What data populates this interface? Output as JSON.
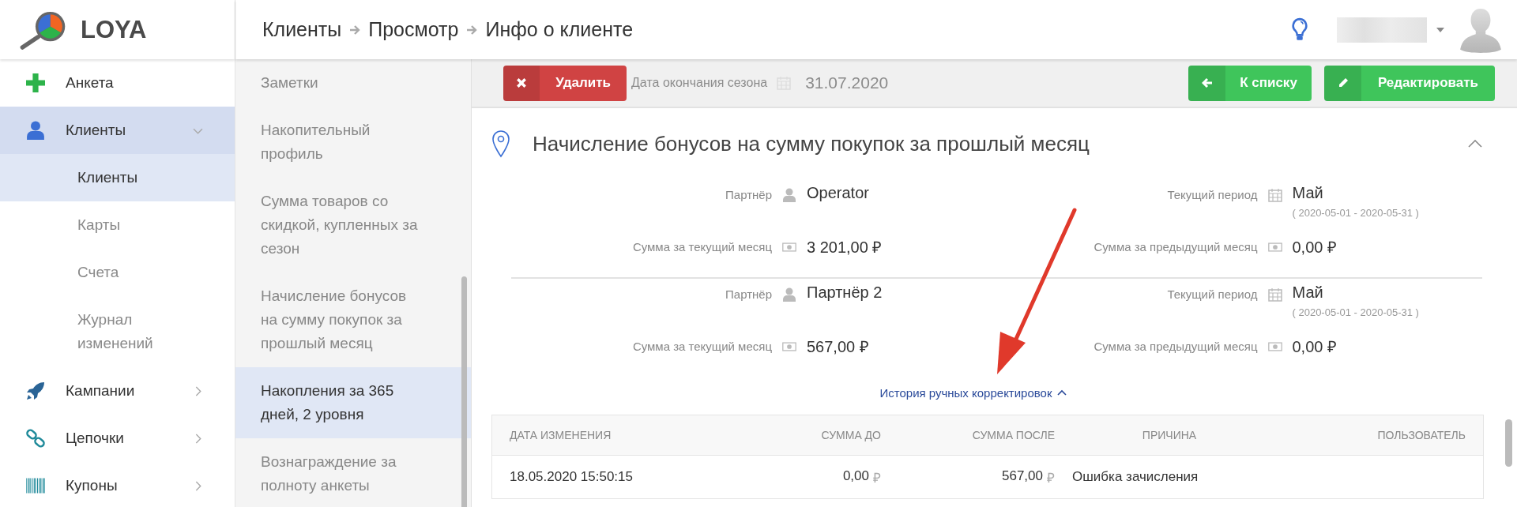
{
  "logo": {
    "text": "LOYA"
  },
  "breadcrumbs": [
    "Клиенты",
    "Просмотр",
    "Инфо о клиенте"
  ],
  "sidebar": {
    "items": [
      {
        "label": "Анкета",
        "kind": "link",
        "selected": false
      },
      {
        "label": "Клиенты",
        "kind": "group",
        "selected": true,
        "expanded": true,
        "children": [
          {
            "label": "Клиенты",
            "selected": true
          },
          {
            "label": "Карты",
            "selected": false
          },
          {
            "label": "Счета",
            "selected": false
          },
          {
            "label": "Журнал изменений",
            "selected": false
          }
        ]
      },
      {
        "label": "Кампании",
        "kind": "group",
        "selected": false,
        "expanded": false
      },
      {
        "label": "Цепочки",
        "kind": "group",
        "selected": false,
        "expanded": false
      },
      {
        "label": "Купоны",
        "kind": "group",
        "selected": false,
        "expanded": false
      }
    ]
  },
  "section_nav": {
    "items": [
      {
        "label": "Заметки",
        "selected": false
      },
      {
        "label": "Накопительный профиль",
        "selected": false
      },
      {
        "label": "Сумма товаров со скидкой, купленных за сезон",
        "selected": false
      },
      {
        "label": "Начисление бонусов на сумму покупок за прошлый месяц",
        "selected": false
      },
      {
        "label": "Накопления за 365 дней, 2 уровня",
        "selected": true
      },
      {
        "label": "Вознаграждение за полноту анкеты",
        "selected": false
      }
    ]
  },
  "toolbar": {
    "delete_button": "Удалить",
    "hidden_field": {
      "label": "Дата окончания сезона",
      "value": "31.07.2020"
    },
    "back_button": "К списку",
    "edit_button": "Редактировать"
  },
  "section": {
    "title": "Начисление бонусов на сумму покупок за прошлый месяц",
    "expanded": true,
    "blocks": [
      {
        "fields": [
          {
            "label": "Партнёр",
            "value": "Operator"
          },
          {
            "label": "Текущий период",
            "value": "Май",
            "sub": "( 2020-05-01 - 2020-05-31 )"
          },
          {
            "label": "Сумма за текущий месяц",
            "value": "3 201,00 ₽"
          },
          {
            "label": "Сумма за предыдущий месяц",
            "value": "0,00 ₽"
          }
        ]
      },
      {
        "fields": [
          {
            "label": "Партнёр",
            "value": "Партнёр 2"
          },
          {
            "label": "Текущий период",
            "value": "Май",
            "sub": "( 2020-05-01 - 2020-05-31 )"
          },
          {
            "label": "Сумма за текущий месяц",
            "value": "567,00 ₽"
          },
          {
            "label": "Сумма за предыдущий месяц",
            "value": "0,00 ₽"
          }
        ]
      }
    ],
    "history_link": {
      "label": "История ручных корректировок",
      "expanded": true
    },
    "table": {
      "columns": [
        "ДАТА ИЗМЕНЕНИЯ",
        "СУММА ДО",
        "СУММА ПОСЛЕ",
        "ПРИЧИНА",
        "ПОЛЬЗОВАТЕЛЬ"
      ],
      "rows": [
        {
          "date": "18.05.2020 15:50:15",
          "before": {
            "amount": "0,00",
            "currency": "₽"
          },
          "after": {
            "amount": "567,00",
            "currency": "₽"
          },
          "reason": "Ошибка зачисления"
        }
      ]
    }
  }
}
